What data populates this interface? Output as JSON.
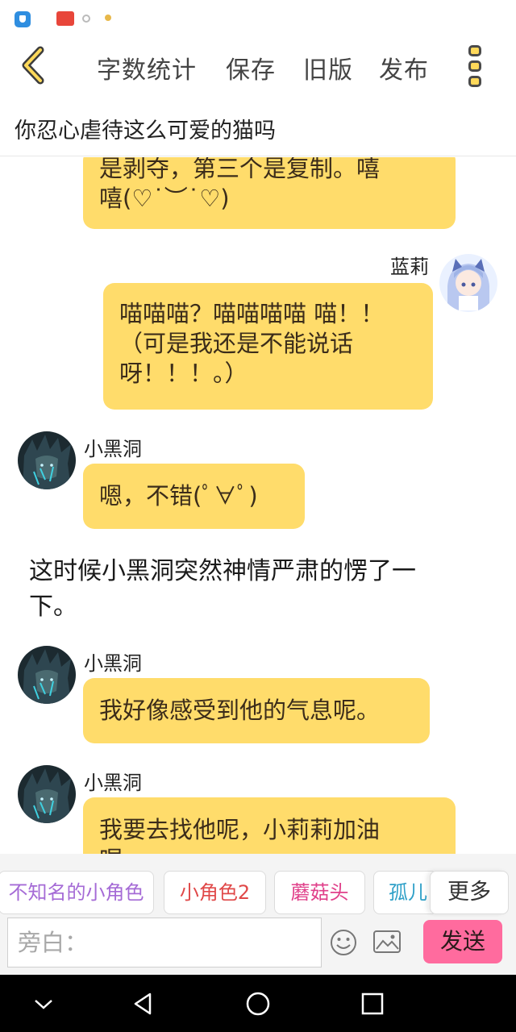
{
  "toolbar": {
    "word_count": "字数统计",
    "save": "保存",
    "old_version": "旧版",
    "publish": "发布"
  },
  "title": "你忍心虐待这么可爱的猫吗",
  "messages": [
    {
      "sender": "",
      "text_lines": [
        "是剥夺，第三个是复制。嘻",
        "嘻(♡˙︶˙♡)"
      ]
    },
    {
      "sender": "蓝莉",
      "text_lines": [
        "喵喵喵？喵喵喵喵 喵！！",
        "（可是我还是不能说话",
        "呀！！！。）"
      ]
    },
    {
      "sender": "小黑洞",
      "text_lines": [
        "嗯，不错(ﾟ∀ﾟ)"
      ]
    },
    {
      "sender": "小黑洞",
      "text_lines": [
        "我好像感受到他的气息呢。"
      ]
    },
    {
      "sender": "小黑洞",
      "text_lines": [
        "我要去找他呢，小莉莉加油",
        "喔"
      ]
    }
  ],
  "narration_lines": [
    "这时候小黑洞突然神情严肃的愣了一",
    "下。"
  ],
  "characters": [
    {
      "label": "不知名的小角色",
      "color": "#a56bd6"
    },
    {
      "label": "小角色2",
      "color": "#e04848"
    },
    {
      "label": "蘑菇头",
      "color": "#e0408a"
    },
    {
      "label": "孤儿",
      "color": "#2fa0c8"
    }
  ],
  "more_label": "更多",
  "input": {
    "placeholder": "旁白："
  },
  "send_label": "发送",
  "colors": {
    "bubble": "#ffdc6b",
    "send": "#ff6b9e",
    "accent": "#ffd95a"
  }
}
